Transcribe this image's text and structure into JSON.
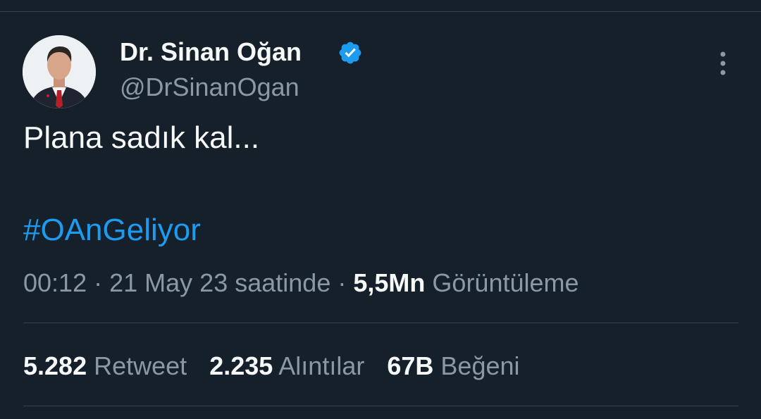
{
  "author": {
    "display_name": "Dr. Sinan Oğan",
    "handle": "@DrSinanOgan",
    "verified": true,
    "verified_color": "#1d9bf0"
  },
  "tweet": {
    "text": "Plana sadık kal...",
    "hashtag": "#OAnGeliyor"
  },
  "meta": {
    "time": "00:12",
    "separator": "·",
    "date": "21 May 23 saatinde",
    "views_count": "5,5Mn",
    "views_label": "Görüntüleme"
  },
  "stats": {
    "retweets_count": "5.282",
    "retweets_label": "Retweet",
    "quotes_count": "2.235",
    "quotes_label": "Alıntılar",
    "likes_count": "67B",
    "likes_label": "Beğeni"
  },
  "icons": {
    "verified": "verified-badge-icon",
    "more": "more-vertical-icon"
  },
  "colors": {
    "background": "#15202b",
    "primary_text": "#f7f9f9",
    "secondary_text": "#8b98a5",
    "link": "#1d9bf0",
    "divider": "#38444d"
  }
}
